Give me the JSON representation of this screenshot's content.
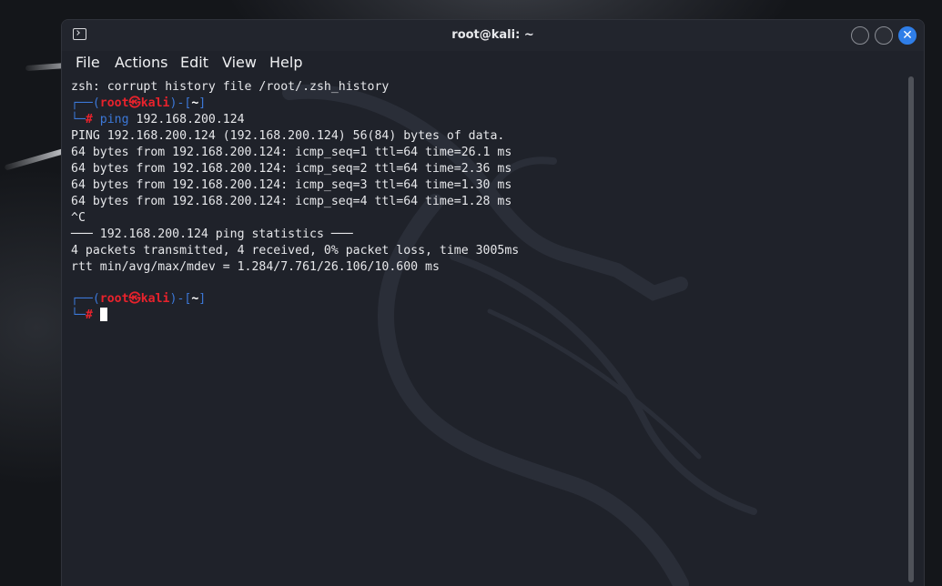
{
  "window": {
    "title": "root@kali: ~"
  },
  "menu": [
    "File",
    "Actions",
    "Edit",
    "View",
    "Help"
  ],
  "terminal": {
    "corrupt_msg": "zsh: corrupt history file /root/.zsh_history",
    "prompt": {
      "corner_top": "┌──",
      "open_paren": "(",
      "user": "root",
      "at_symbol": "㉿",
      "host": "kali",
      "close_paren_dash": ")-[",
      "dir": "~",
      "close_bracket": "]",
      "corner_bottom": "└─",
      "hash": "#"
    },
    "command": "ping",
    "command_arg": "192.168.200.124",
    "output": [
      "PING 192.168.200.124 (192.168.200.124) 56(84) bytes of data.",
      "64 bytes from 192.168.200.124: icmp_seq=1 ttl=64 time=26.1 ms",
      "64 bytes from 192.168.200.124: icmp_seq=2 ttl=64 time=2.36 ms",
      "64 bytes from 192.168.200.124: icmp_seq=3 ttl=64 time=1.30 ms",
      "64 bytes from 192.168.200.124: icmp_seq=4 ttl=64 time=1.28 ms",
      "^C",
      "─── 192.168.200.124 ping statistics ───",
      "4 packets transmitted, 4 received, 0% packet loss, time 3005ms",
      "rtt min/avg/max/mdev = 1.284/7.761/26.106/10.600 ms"
    ]
  },
  "colors": {
    "prompt_blue": "#3c78d8",
    "prompt_red": "#e8222c",
    "close_button": "#2f7ee8",
    "terminal_bg": "#1f222a"
  },
  "icons": {
    "app": "terminal-icon",
    "close": "close-icon"
  }
}
